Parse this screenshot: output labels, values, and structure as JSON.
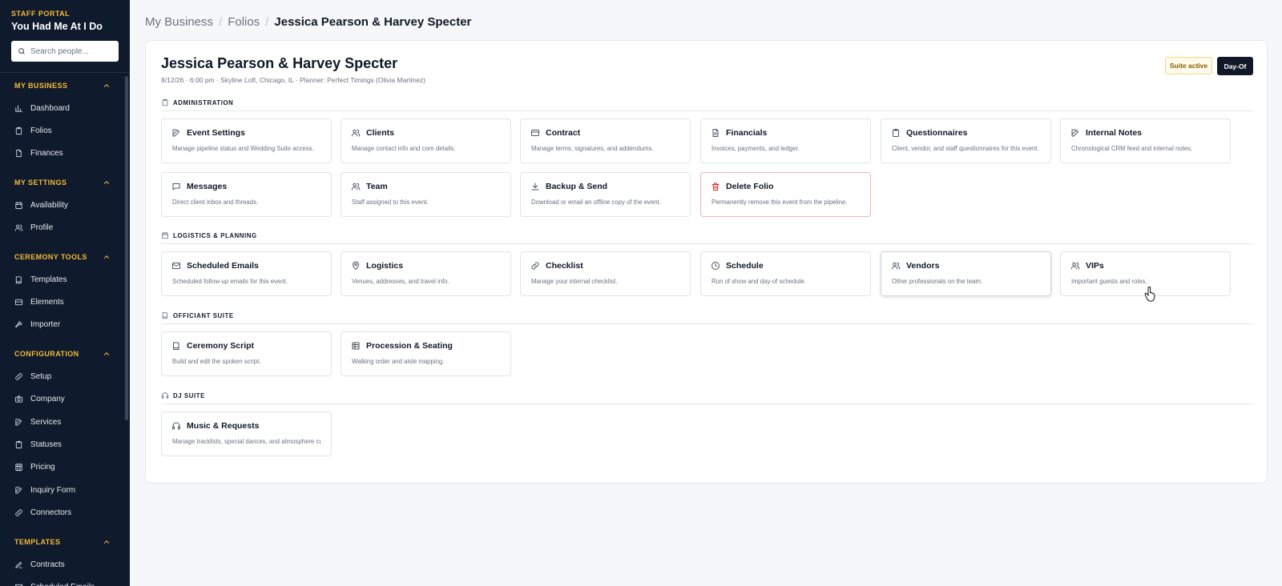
{
  "sidebar": {
    "portal_label": "STAFF PORTAL",
    "brand": "You Had Me At I Do",
    "search_placeholder": "Search people...",
    "sections": [
      {
        "title": "MY BUSINESS",
        "items": [
          {
            "label": "Dashboard",
            "icon": "bar-chart-icon"
          },
          {
            "label": "Folios",
            "icon": "clipboard-icon"
          },
          {
            "label": "Finances",
            "icon": "file-icon"
          }
        ]
      },
      {
        "title": "MY SETTINGS",
        "items": [
          {
            "label": "Availability",
            "icon": "calendar-icon"
          },
          {
            "label": "Profile",
            "icon": "users-icon"
          }
        ]
      },
      {
        "title": "CEREMONY TOOLS",
        "items": [
          {
            "label": "Templates",
            "icon": "book-icon"
          },
          {
            "label": "Elements",
            "icon": "layout-icon"
          },
          {
            "label": "Importer",
            "icon": "hammer-icon"
          }
        ]
      },
      {
        "title": "CONFIGURATION",
        "items": [
          {
            "label": "Setup",
            "icon": "link-icon"
          },
          {
            "label": "Company",
            "icon": "camera-icon"
          },
          {
            "label": "Services",
            "icon": "edit-icon"
          },
          {
            "label": "Statuses",
            "icon": "clipboard-icon"
          },
          {
            "label": "Pricing",
            "icon": "building-icon"
          },
          {
            "label": "Inquiry Form",
            "icon": "edit-icon"
          },
          {
            "label": "Connectors",
            "icon": "link-icon"
          }
        ]
      },
      {
        "title": "TEMPLATES",
        "items": [
          {
            "label": "Contracts",
            "icon": "pen-icon"
          },
          {
            "label": "Scheduled Emails",
            "icon": "mail-icon"
          }
        ]
      }
    ]
  },
  "breadcrumb": {
    "items": [
      "My Business",
      "Folios"
    ],
    "separator": "/",
    "current": "Jessica Pearson & Harvey Specter"
  },
  "folio": {
    "title": "Jessica Pearson & Harvey Specter",
    "meta": "8/12/26 · 6:00 pm · Skyline Loft, Chicago, IL · Planner: Perfect Timings (Olivia Martinez)",
    "suite_badge": "Suite active",
    "dayof_button": "Day-Of"
  },
  "groups": [
    {
      "label": "ADMINISTRATION",
      "icon": "clipboard-icon",
      "tiles": [
        {
          "title": "Event Settings",
          "desc": "Manage pipeline status and Wedding Suite access.",
          "icon": "edit-icon"
        },
        {
          "title": "Clients",
          "desc": "Manage contact info and core details.",
          "icon": "users-icon"
        },
        {
          "title": "Contract",
          "desc": "Manage terms, signatures, and addendums.",
          "icon": "credit-card-icon"
        },
        {
          "title": "Financials",
          "desc": "Invoices, payments, and ledger.",
          "icon": "file-text-icon"
        },
        {
          "title": "Questionnaires",
          "desc": "Client, vendor, and staff questionnaires for this event.",
          "icon": "clipboard-icon"
        },
        {
          "title": "Internal Notes",
          "desc": "Chronological CRM feed and internal notes.",
          "icon": "edit-icon"
        },
        {
          "title": "Messages",
          "desc": "Direct client inbox and threads.",
          "icon": "message-icon"
        },
        {
          "title": "Team",
          "desc": "Staff assigned to this event.",
          "icon": "users-icon"
        },
        {
          "title": "Backup & Send",
          "desc": "Download or email an offline copy of the event.",
          "icon": "download-icon"
        },
        {
          "title": "Delete Folio",
          "desc": "Permanently remove this event from the pipeline.",
          "icon": "trash-icon",
          "danger": true
        }
      ]
    },
    {
      "label": "LOGISTICS & PLANNING",
      "icon": "calendar-icon",
      "tiles": [
        {
          "title": "Scheduled Emails",
          "desc": "Scheduled follow-up emails for this event.",
          "icon": "mail-icon"
        },
        {
          "title": "Logistics",
          "desc": "Venues, addresses, and travel info.",
          "icon": "map-pin-icon"
        },
        {
          "title": "Checklist",
          "desc": "Manage your internal checklist.",
          "icon": "link-icon"
        },
        {
          "title": "Schedule",
          "desc": "Run of show and day-of schedule.",
          "icon": "clock-icon"
        },
        {
          "title": "Vendors",
          "desc": "Other professionals on the team.",
          "icon": "users-icon"
        },
        {
          "title": "VIPs",
          "desc": "Important guests and roles.",
          "icon": "users-icon"
        }
      ]
    },
    {
      "label": "OFFICIANT SUITE",
      "icon": "book-icon",
      "tiles": [
        {
          "title": "Ceremony Script",
          "desc": "Build and edit the spoken script.",
          "icon": "book-icon"
        },
        {
          "title": "Procession & Seating",
          "desc": "Walking order and aisle mapping.",
          "icon": "grid-icon"
        }
      ]
    },
    {
      "label": "DJ SUITE",
      "icon": "headphones-icon",
      "tiles": [
        {
          "title": "Music & Requests",
          "desc": "Manage tracklists, special dances, and atmosphere cues.",
          "icon": "headphones-icon"
        }
      ]
    }
  ],
  "colors": {
    "sidebar_bg": "#0f1b2d",
    "section_accent": "#f5b935",
    "danger": "#dc2626"
  }
}
